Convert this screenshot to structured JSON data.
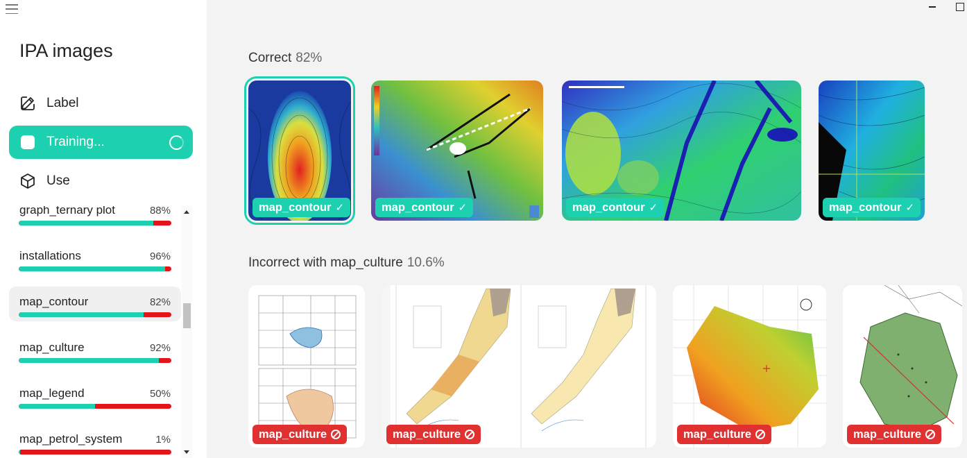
{
  "app": {
    "title": "IPA images"
  },
  "nav": {
    "label": "Label",
    "training": "Training...",
    "use": "Use"
  },
  "classes": [
    {
      "name": "graph_ternary plot",
      "pct": "88%",
      "accuracy": 0.88
    },
    {
      "name": "installations",
      "pct": "96%",
      "accuracy": 0.96
    },
    {
      "name": "map_contour",
      "pct": "82%",
      "accuracy": 0.82,
      "selected": true
    },
    {
      "name": "map_culture",
      "pct": "92%",
      "accuracy": 0.92
    },
    {
      "name": "map_legend",
      "pct": "50%",
      "accuracy": 0.5
    },
    {
      "name": "map_petrol_system",
      "pct": "1%",
      "accuracy": 0.01
    }
  ],
  "correct": {
    "title": "Correct",
    "pct": "82%",
    "images": [
      {
        "label": "map_contour",
        "status": "correct"
      },
      {
        "label": "map_contour",
        "status": "correct"
      },
      {
        "label": "map_contour",
        "status": "correct"
      },
      {
        "label": "map_contour",
        "status": "correct"
      }
    ]
  },
  "incorrect": {
    "title": "Incorrect with map_culture",
    "pct": "10.6%",
    "images": [
      {
        "label": "map_culture",
        "status": "incorrect"
      },
      {
        "label": "map_culture",
        "status": "incorrect"
      },
      {
        "label": "map_culture",
        "status": "incorrect"
      },
      {
        "label": "map_culture",
        "status": "incorrect"
      }
    ]
  },
  "colors": {
    "accent": "#1cd0b0",
    "error": "#e3151b"
  }
}
